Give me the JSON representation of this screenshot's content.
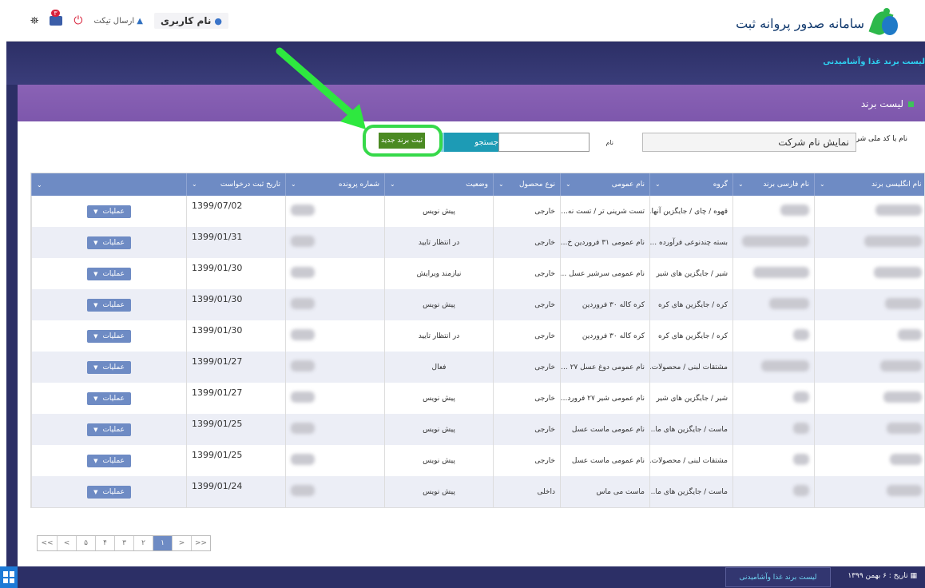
{
  "header": {
    "app_title": "سامانه صدور پروانه ثبت",
    "user_label": "نام کاربری",
    "send_ticket": "ارسال تیکت",
    "mail_badge": "۳",
    "section_link": "لیست برند غذا وآشامیدنی"
  },
  "panel": {
    "title": "لیست برند"
  },
  "search": {
    "company_label": "نام یا کد ملی شرکت",
    "company_value": "نمایش نام شرکت",
    "name_label": "نام",
    "search_button": "جستجو",
    "new_button": "ثبت برند جدید"
  },
  "table": {
    "columns": [
      "نام انگلیسی برند",
      "نام فارسی برند",
      "گروه",
      "نام عمومی",
      "نوع محصول",
      "وضعیت",
      "شماره پرونده",
      "تاریخ ثبت درخواست",
      ""
    ],
    "ops_label": "عملیات",
    "rows": [
      {
        "group": "قهوه / چای / جایگزین آنها...",
        "generic": "تست شرینی تر / تست نه...",
        "type": "خارجی",
        "status": "پیش نویس",
        "date": "1399/07/02"
      },
      {
        "group": "بسته چندنوعی فرآورده ...",
        "generic": "نام عمومی ۳۱ فروردین خ...",
        "type": "خارجی",
        "status": "در انتظار تایید",
        "date": "1399/01/31"
      },
      {
        "group": "شیر / جایگزین های شیر",
        "generic": "نام عمومی سرشیر عسل ...",
        "type": "خارجی",
        "status": "نیازمند ویرایش",
        "date": "1399/01/30"
      },
      {
        "group": "کره / جایگزین های کره",
        "generic": "کره کاله ۳۰ فروردین",
        "type": "خارجی",
        "status": "پیش نویس",
        "date": "1399/01/30"
      },
      {
        "group": "کره / جایگزین های کره",
        "generic": "کره کاله ۳۰ فروردین",
        "type": "خارجی",
        "status": "در انتظار تایید",
        "date": "1399/01/30"
      },
      {
        "group": "مشتقات لبنی / محصولات...",
        "generic": "نام عمومی دوغ عسل ۲۷ ...",
        "type": "خارجی",
        "status": "فعال",
        "date": "1399/01/27"
      },
      {
        "group": "شیر / جایگزین های شیر",
        "generic": "نام عمومی شیر ۲۷ فرورد...",
        "type": "خارجی",
        "status": "پیش نویس",
        "date": "1399/01/27"
      },
      {
        "group": "ماست / جایگزین های ما...",
        "generic": "نام عمومی ماست عسل",
        "type": "خارجی",
        "status": "پیش نویس",
        "date": "1399/01/25"
      },
      {
        "group": "مشتقات لبنی / محصولات...",
        "generic": "نام عمومی ماست عسل",
        "type": "خارجی",
        "status": "پیش نویس",
        "date": "1399/01/25"
      },
      {
        "group": "ماست / جایگزین های ما...",
        "generic": "ماست می ماس",
        "type": "داخلی",
        "status": "پیش نویس",
        "date": "1399/01/24"
      }
    ]
  },
  "pagination": [
    "<<",
    "<",
    "۵",
    "۴",
    "۳",
    "۲",
    "۱",
    ">",
    ">>"
  ],
  "pagination_active": "۱",
  "footer": {
    "date": "تاریخ : ۶ بهمن ۱۳۹۹",
    "tab": "لیست برند غذا وآشامیدنی"
  },
  "colors": {
    "purple_header": "#7d57ac",
    "table_header": "#6e8bc4",
    "dark_band": "#2c2f66",
    "new_button": "#4b8a22",
    "highlight_green": "#36d94a"
  }
}
